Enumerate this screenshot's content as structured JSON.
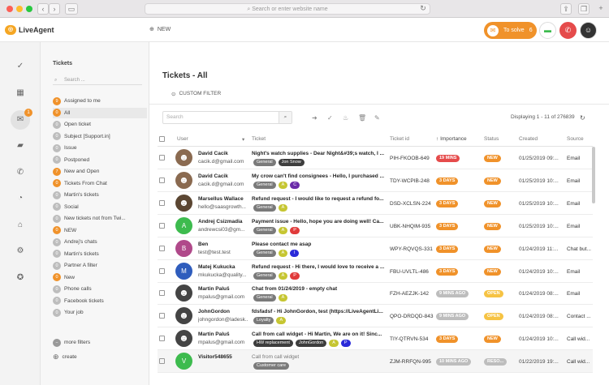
{
  "browser": {
    "url_placeholder": "Search or enter website name"
  },
  "app": {
    "logo": "LiveAgent",
    "new_label": "NEW",
    "to_solve_label": "To solve",
    "to_solve_count": "6"
  },
  "colors": {
    "accent": "#f0922a",
    "green": "#3dbb4e",
    "red": "#e54b4b"
  },
  "leftnav": {
    "badge": "1"
  },
  "sidebar": {
    "title": "Tickets",
    "search_placeholder": "Search ...",
    "items": [
      {
        "count": "9",
        "label": "Assigned to me",
        "orange": true
      },
      {
        "count": "0",
        "label": "All",
        "orange": true
      },
      {
        "count": "0",
        "label": "Open ticket"
      },
      {
        "count": "0",
        "label": "Subject [Support.in]"
      },
      {
        "count": "0",
        "label": "Issue"
      },
      {
        "count": "0",
        "label": "Postponed"
      },
      {
        "count": "7",
        "label": "New and Open",
        "orange": true
      },
      {
        "count": "0",
        "label": "Tickets From Chat",
        "orange": true
      },
      {
        "count": "0",
        "label": "Martin's tickets"
      },
      {
        "count": "0",
        "label": "Social"
      },
      {
        "count": "0",
        "label": "New tickets not from Twi..."
      },
      {
        "count": "0",
        "label": "NEW",
        "orange": true
      },
      {
        "count": "0",
        "label": "Andrej's chats"
      },
      {
        "count": "0",
        "label": "Martin's tickets"
      },
      {
        "count": "0",
        "label": "Partner A filter"
      },
      {
        "count": "0",
        "label": "New",
        "orange": true
      },
      {
        "count": "0",
        "label": "Phone calls"
      },
      {
        "count": "0",
        "label": "Facebook tickets"
      },
      {
        "count": "0",
        "label": "Your job"
      }
    ],
    "more_filters": "more filters",
    "create": "create"
  },
  "main": {
    "title": "Tickets - All",
    "custom_filter": "CUSTOM FILTER",
    "search_placeholder": "Search",
    "displaying": "Displaying 1 - 11 of 276839",
    "columns": {
      "user": "User",
      "ticket": "Ticket",
      "ticket_id": "Ticket id",
      "importance": "Importance",
      "status": "Status",
      "created": "Created",
      "source": "Source"
    },
    "rows": [
      {
        "name": "David Cacik",
        "email": "cacik.d@gmail.com",
        "subject": "Night's watch supplies - Dear Night&#39;s watch, I ...",
        "tags": [
          [
            "General",
            "g"
          ],
          [
            "Jon Snow",
            "d"
          ]
        ],
        "tid": "PIH-FKOOB-649",
        "imp": "19 MINS",
        "impc": "red",
        "status": "NEW",
        "sc": "new",
        "created": "01/25/2019 09:...",
        "source": "Email",
        "avc": "#8a6a50",
        "avl": "",
        "grey": false
      },
      {
        "name": "David Cacik",
        "email": "cacik.d@gmail.com",
        "subject": "My crow can't find consignees - Hello, I purchased ...",
        "tags": [
          [
            "General",
            "g"
          ],
          [
            "A",
            "y"
          ],
          [
            "C",
            "v"
          ]
        ],
        "tid": "TDY-WCPIB-248",
        "imp": "3 DAYS",
        "impc": "org",
        "status": "NEW",
        "sc": "new",
        "created": "01/25/2019 10:...",
        "source": "Email",
        "avc": "#8a6a50",
        "avl": "",
        "grey": false
      },
      {
        "name": "Marsellus Wallace",
        "email": "hello@saasgrowth...",
        "subject": "Refund request - I would like to request a refund fo...",
        "tags": [
          [
            "General",
            "g"
          ],
          [
            "A",
            "y"
          ]
        ],
        "tid": "DSD-XCLSN-224",
        "imp": "3 DAYS",
        "impc": "org",
        "status": "NEW",
        "sc": "new",
        "created": "01/25/2019 10:...",
        "source": "Email",
        "avc": "#5b4632",
        "avl": "",
        "grey": false
      },
      {
        "name": "Andrej Csizmadia",
        "email": "andrewcsi03@gm...",
        "subject": "Payment issue - Hello, hope you are doing well! Ca...",
        "tags": [
          [
            "General",
            "g"
          ],
          [
            "A",
            "y"
          ],
          [
            "P",
            "r"
          ]
        ],
        "tid": "UBK-NHQIM-935",
        "imp": "3 DAYS",
        "impc": "org",
        "status": "NEW",
        "sc": "new",
        "created": "01/25/2019 10:...",
        "source": "Email",
        "avc": "#3dbb4e",
        "avl": "A",
        "grey": false
      },
      {
        "name": "Ben",
        "email": "test@test.test",
        "subject": "Please contact me asap",
        "tags": [
          [
            "General",
            "g"
          ],
          [
            "A",
            "y"
          ],
          [
            "I",
            "b"
          ]
        ],
        "tid": "WPY-RQVQS-331",
        "imp": "3 DAYS",
        "impc": "org",
        "status": "NEW",
        "sc": "new",
        "created": "01/24/2019 11:...",
        "source": "Chat but...",
        "avc": "#b0498a",
        "avl": "B",
        "grey": false
      },
      {
        "name": "Matej Kukucka",
        "email": "mkukucka@quality...",
        "subject": "Refund request - Hi there, I would love to receive a ...",
        "tags": [
          [
            "General",
            "g"
          ],
          [
            "A",
            "y"
          ],
          [
            "P",
            "r"
          ]
        ],
        "tid": "FBU-UVLTL-486",
        "imp": "3 DAYS",
        "impc": "org",
        "status": "NEW",
        "sc": "new",
        "created": "01/24/2019 10:...",
        "source": "Email",
        "avc": "#2f5dbd",
        "avl": "M",
        "grey": false
      },
      {
        "name": "Martin Paluš",
        "email": "mpalus@gmail.com",
        "subject": "Chat from 01/24/2019 - empty chat",
        "tags": [
          [
            "General",
            "g"
          ],
          [
            "A",
            "y"
          ]
        ],
        "tid": "FZH-AEZJK-142",
        "imp": "9 MINS AGO",
        "impc": "gry",
        "status": "OPEN",
        "sc": "open",
        "created": "01/24/2019 08:...",
        "source": "Email",
        "avc": "#444",
        "avl": "",
        "grey": false
      },
      {
        "name": "JohnGordon",
        "email": "johngordon@ladesk...",
        "subject": "fdsfadsf - Hi JohnGordon, test (https://LiveAgentLi...",
        "tags": [
          [
            "Loyalty",
            "g"
          ],
          [
            "A",
            "y"
          ]
        ],
        "tid": "QPO-DRDQD-843",
        "imp": "9 MINS AGO",
        "impc": "gry",
        "status": "OPEN",
        "sc": "open",
        "created": "01/24/2019 08:...",
        "source": "Contact ...",
        "avc": "#444",
        "avl": "",
        "grey": false
      },
      {
        "name": "Martin Paluš",
        "email": "mpalus@gmail.com",
        "subject": "Call from call widget - Hi Martin, We are on it! Sinc...",
        "tags": [
          [
            "HW replacement",
            "d"
          ],
          [
            "JohnGordon",
            "d"
          ],
          [
            "A",
            "y"
          ],
          [
            "P",
            "b"
          ]
        ],
        "tid": "TIY-QTRVN-534",
        "imp": "3 DAYS",
        "impc": "org",
        "status": "NEW",
        "sc": "new",
        "created": "01/24/2019 10:...",
        "source": "Call wid...",
        "avc": "#444",
        "avl": "",
        "grey": false
      },
      {
        "name": "Visitor548655",
        "email": "",
        "subject": "Call from call widget",
        "tags": [
          [
            "Customer care",
            "g"
          ]
        ],
        "tid": "ZJM-RRFQN-995",
        "imp": "10 MINS AGO",
        "impc": "gry",
        "status": "RESO...",
        "sc": "res",
        "created": "01/22/2019 19:...",
        "source": "Call wid...",
        "avc": "#3dbb4e",
        "avl": "V",
        "grey": true
      }
    ]
  }
}
